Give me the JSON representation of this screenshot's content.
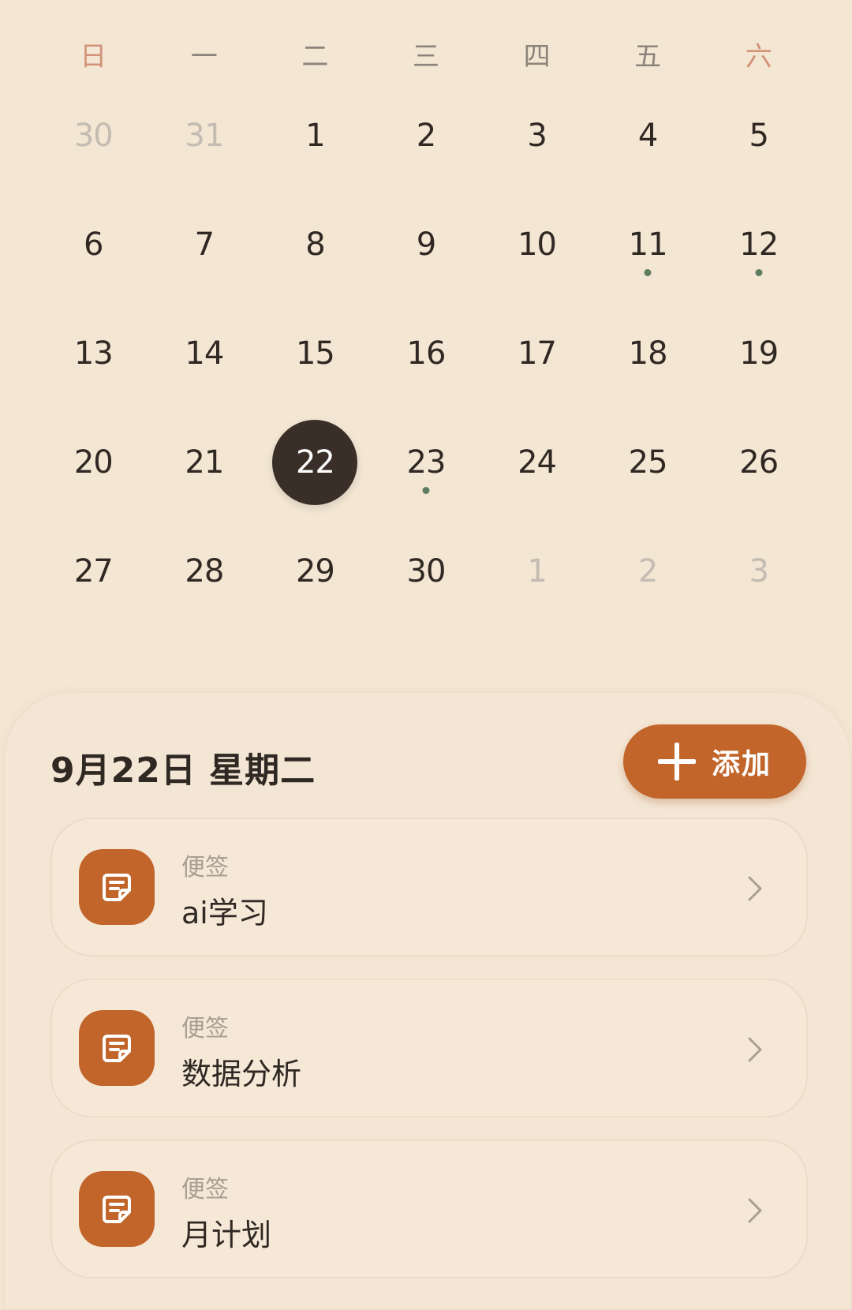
{
  "calendar": {
    "weekdays": [
      "日",
      "一",
      "二",
      "三",
      "四",
      "五",
      "六"
    ],
    "days": [
      {
        "n": "30",
        "muted": true
      },
      {
        "n": "31",
        "muted": true
      },
      {
        "n": "1"
      },
      {
        "n": "2"
      },
      {
        "n": "3"
      },
      {
        "n": "4"
      },
      {
        "n": "5"
      },
      {
        "n": "6"
      },
      {
        "n": "7"
      },
      {
        "n": "8"
      },
      {
        "n": "9"
      },
      {
        "n": "10"
      },
      {
        "n": "11",
        "dot": "green"
      },
      {
        "n": "12",
        "dot": "green"
      },
      {
        "n": "13"
      },
      {
        "n": "14"
      },
      {
        "n": "15"
      },
      {
        "n": "16"
      },
      {
        "n": "17"
      },
      {
        "n": "18"
      },
      {
        "n": "19"
      },
      {
        "n": "20"
      },
      {
        "n": "21"
      },
      {
        "n": "22",
        "selected": true,
        "dot": "orange"
      },
      {
        "n": "23",
        "dot": "green"
      },
      {
        "n": "24"
      },
      {
        "n": "25"
      },
      {
        "n": "26"
      },
      {
        "n": "27"
      },
      {
        "n": "28"
      },
      {
        "n": "29"
      },
      {
        "n": "30"
      },
      {
        "n": "1",
        "muted": true
      },
      {
        "n": "2",
        "muted": true
      },
      {
        "n": "3",
        "muted": true
      }
    ],
    "colors": {
      "weekend_header": "#d39178",
      "selected_bg": "#3a2f28",
      "event_dot_green": "#5f7d62",
      "event_dot_orange": "#c36a2c"
    }
  },
  "sheet": {
    "date_heading": "9月22日 星期二",
    "add_button": {
      "label": "添加",
      "icon": "plus-icon"
    },
    "notes": [
      {
        "type": "便签",
        "title": "ai学习",
        "icon": "note-icon"
      },
      {
        "type": "便签",
        "title": "数据分析",
        "icon": "note-icon"
      },
      {
        "type": "便签",
        "title": "月计划",
        "icon": "note-icon"
      }
    ],
    "accent_color": "#c1652a"
  }
}
